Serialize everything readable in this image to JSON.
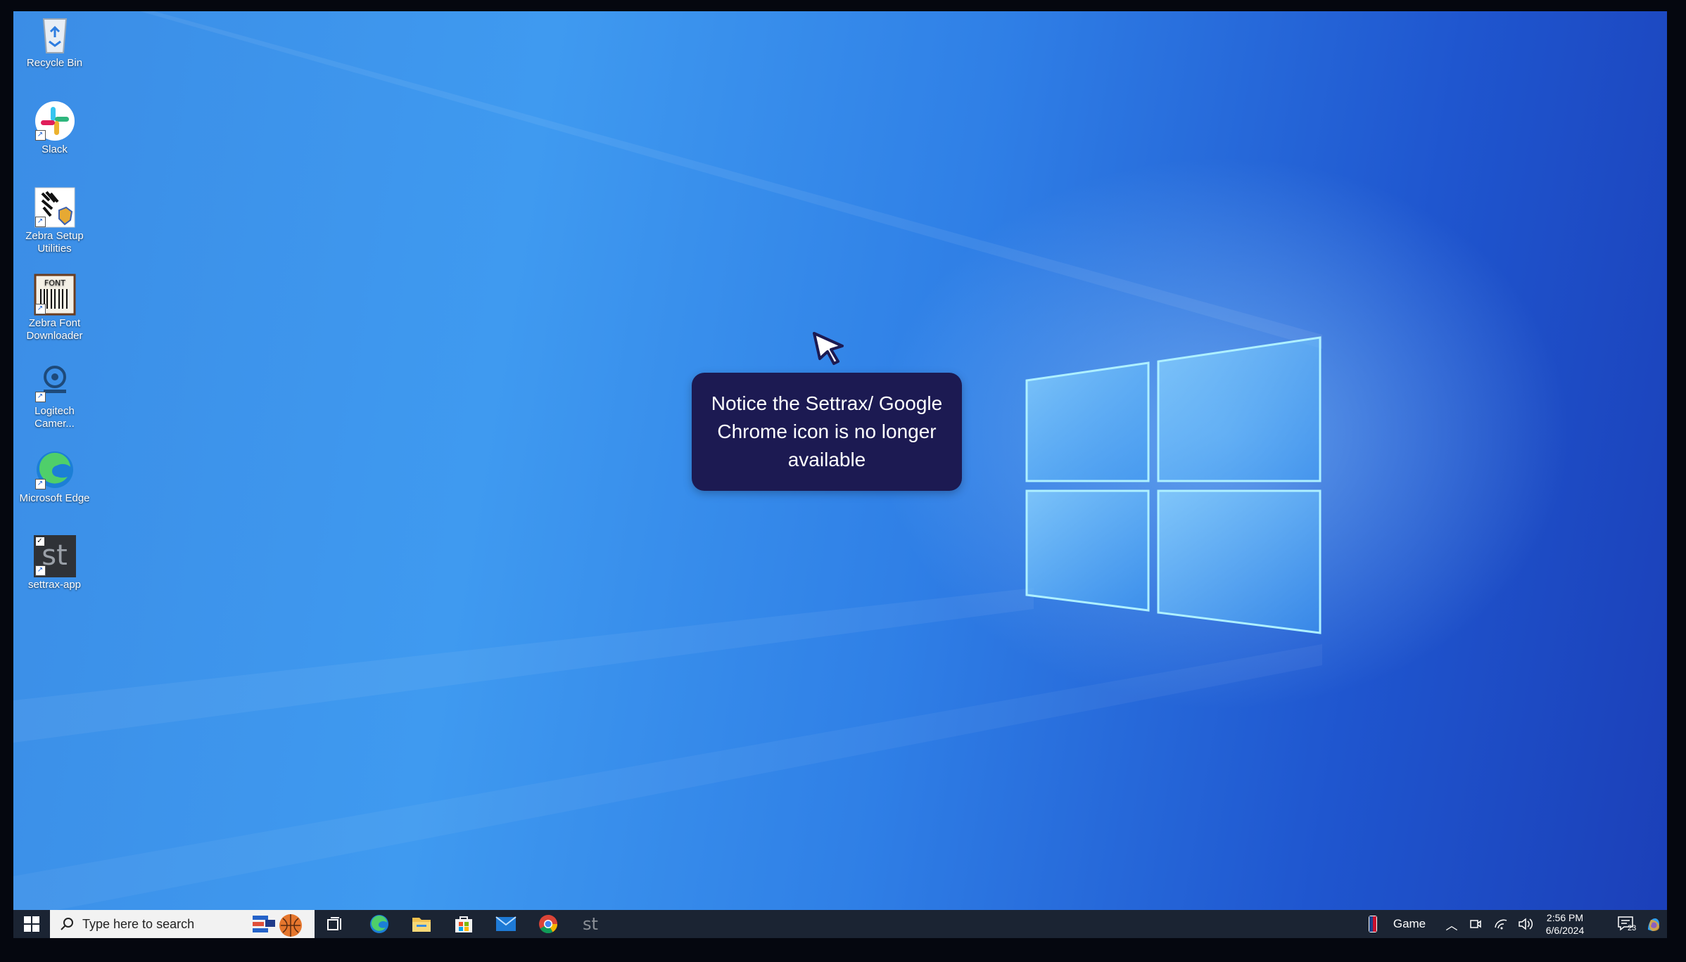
{
  "desktop": {
    "icons": [
      {
        "label": "Recycle Bin",
        "icon": "recycle-bin-icon"
      },
      {
        "label": "Slack",
        "icon": "slack-icon"
      },
      {
        "label": "Zebra Setup Utilities",
        "icon": "zebra-setup-icon"
      },
      {
        "label": "Zebra Font Downloader",
        "icon": "zebra-font-icon",
        "badge": "FONT"
      },
      {
        "label": "Logitech Camer...",
        "icon": "logitech-camera-icon"
      },
      {
        "label": "Microsoft Edge",
        "icon": "edge-icon"
      },
      {
        "label": "settrax-app",
        "icon": "settrax-icon",
        "badge": "st"
      }
    ]
  },
  "callout": {
    "text": "Notice the Settrax/ Google Chrome icon is no longer available"
  },
  "taskbar": {
    "search_placeholder": "Type here to search",
    "pinned": [
      "task-view-icon",
      "edge-icon",
      "file-explorer-icon",
      "store-icon",
      "mail-icon",
      "chrome-icon",
      "settrax-icon"
    ],
    "settrax_label": "st",
    "tray": {
      "game_label": "Game",
      "time": "2:56 PM",
      "date": "6/6/2024",
      "notification_count": "23"
    }
  },
  "colors": {
    "callout_bg": "#1c1a52",
    "taskbar_bg": "#1b2433",
    "desktop_blue": "#3b8de6"
  }
}
